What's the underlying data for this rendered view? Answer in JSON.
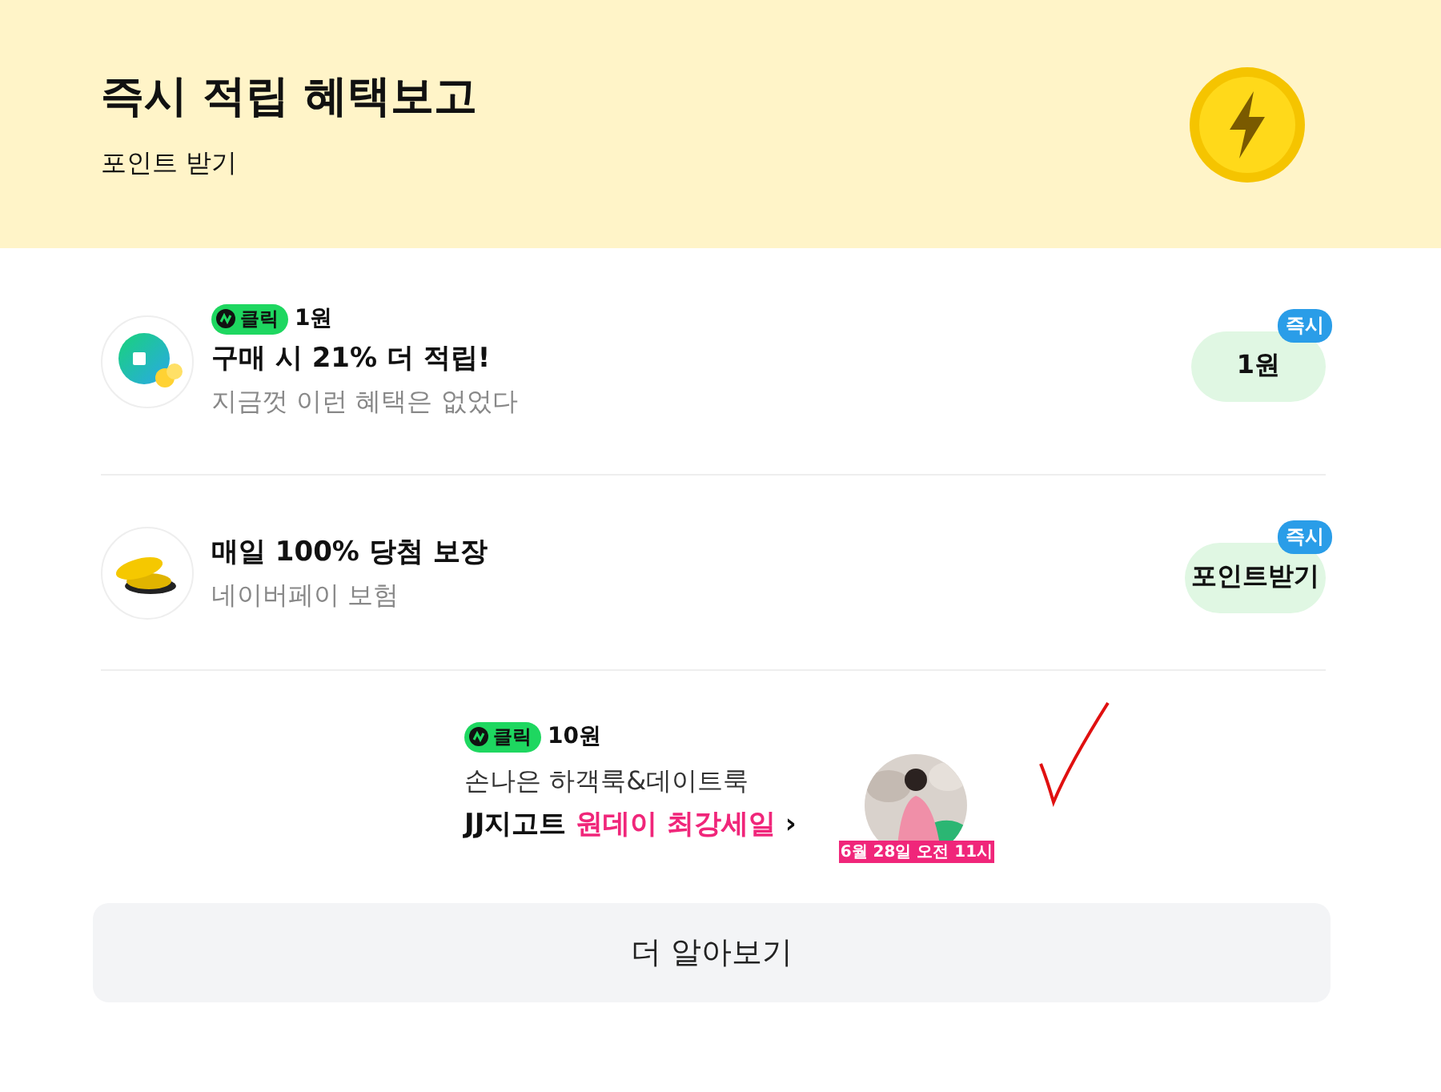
{
  "header": {
    "title": "즉시 적립 혜택보고",
    "subtitle": "포인트 받기"
  },
  "offers": [
    {
      "kind": "shopping",
      "click": {
        "label": "클릭",
        "reward": "1원"
      },
      "title": "구매 시 21% 더 적립!",
      "subtitle": "지금껏 이런 혜택은 없었다",
      "button": "1원",
      "badge": "즉시"
    },
    {
      "kind": "coins",
      "title": "매일 100% 당첨 보장",
      "subtitle": "네이버페이 보험",
      "button": "포인트받기",
      "badge": "즉시"
    }
  ],
  "ad": {
    "click": {
      "label": "클릭",
      "reward": "10원"
    },
    "line1": "손나은 하객룩&데이트룩",
    "brand": "JJ지고트",
    "highlight": "원데이 최강세일",
    "arrow": "›",
    "picture": {
      "kind": "picture",
      "caption": "6월 28일 오전 11시"
    }
  },
  "more_button": "더 알아보기"
}
